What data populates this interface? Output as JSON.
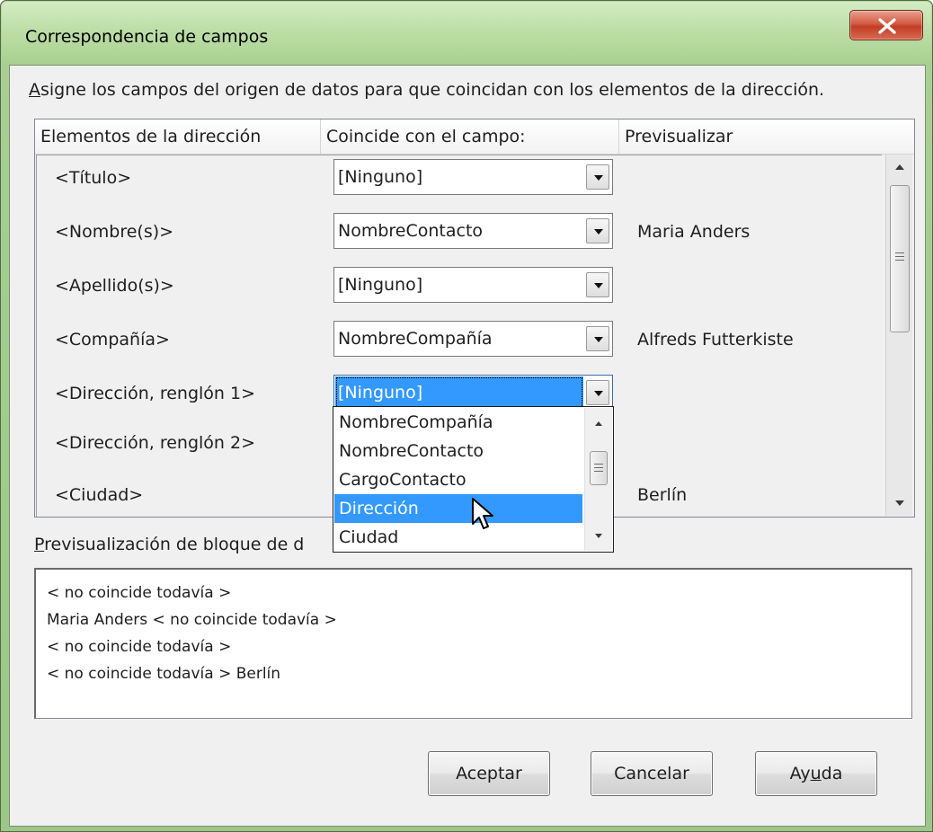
{
  "window": {
    "title": "Correspondencia de campos",
    "close_glyph": "x"
  },
  "instruction": {
    "first_char": "A",
    "rest": "signe los campos del origen de datos para que coincidan con los elementos de la dirección."
  },
  "table": {
    "columns": [
      "Elementos de la dirección",
      "Coincide con el campo:",
      "Previsualizar"
    ],
    "rows": [
      {
        "element": "<Título>",
        "field": "[Ninguno]",
        "preview": ""
      },
      {
        "element": "<Nombre(s)>",
        "field": "NombreContacto",
        "preview": "Maria Anders"
      },
      {
        "element": "<Apellido(s)>",
        "field": "[Ninguno]",
        "preview": ""
      },
      {
        "element": "<Compañía>",
        "field": "NombreCompañía",
        "preview": "Alfreds Futterkiste"
      },
      {
        "element": "<Dirección, renglón 1>",
        "field": "[Ninguno]",
        "preview": ""
      },
      {
        "element": "<Dirección, renglón 2>",
        "field": "",
        "preview": ""
      },
      {
        "element": "<Ciudad>",
        "field": "",
        "preview": "Berlín"
      }
    ]
  },
  "dropdown": {
    "items": [
      "NombreCompañía",
      "NombreContacto",
      "CargoContacto",
      "Dirección",
      "Ciudad"
    ],
    "selected": "Dirección"
  },
  "preview": {
    "label_first_char": "P",
    "label_rest": "revisualización de bloque de d",
    "lines": [
      "< no coincide todavía >",
      "Maria Anders < no coincide todavía >",
      "< no coincide todavía >",
      "< no coincide todavía > Berlín"
    ]
  },
  "buttons": {
    "ok": "Aceptar",
    "cancel": "Cancelar",
    "help_before": "Ay",
    "help_ul": "u",
    "help_after": "da"
  },
  "colors": {
    "title_bar": "#b9d9a3",
    "selection": "#3399ff",
    "close_button": "#c13e25"
  }
}
